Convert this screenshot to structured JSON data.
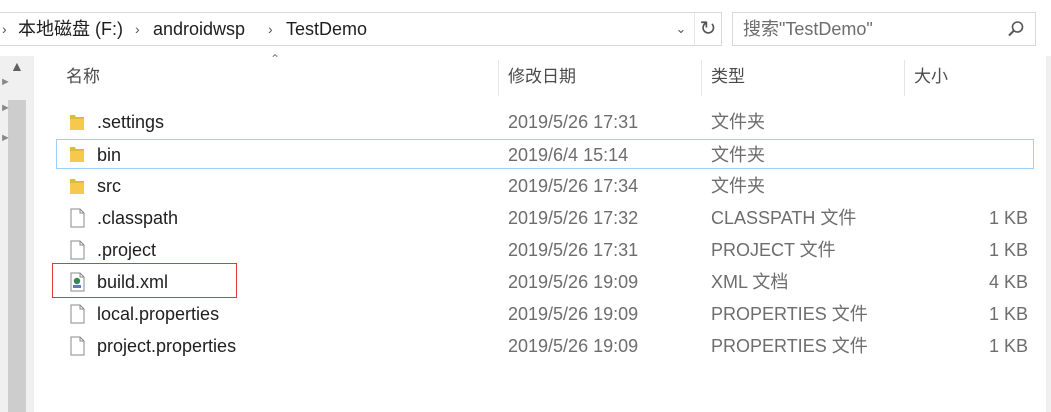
{
  "address": {
    "crumbs": [
      "本地磁盘 (F:)",
      "androidwsp",
      "TestDemo"
    ],
    "separator": "›"
  },
  "search": {
    "placeholder": "搜索\"TestDemo\""
  },
  "columns": {
    "name": "名称",
    "date": "修改日期",
    "type": "类型",
    "size": "大小"
  },
  "rows": [
    {
      "name": ".settings",
      "date": "2019/5/26 17:31",
      "type": "文件夹",
      "size": "",
      "icon": "folder-icon"
    },
    {
      "name": "bin",
      "date": "2019/6/4 15:14",
      "type": "文件夹",
      "size": "",
      "icon": "folder-icon"
    },
    {
      "name": "src",
      "date": "2019/5/26 17:34",
      "type": "文件夹",
      "size": "",
      "icon": "folder-icon"
    },
    {
      "name": ".classpath",
      "date": "2019/5/26 17:32",
      "type": "CLASSPATH 文件",
      "size": "1 KB",
      "icon": "file-icon"
    },
    {
      "name": ".project",
      "date": "2019/5/26 17:31",
      "type": "PROJECT 文件",
      "size": "1 KB",
      "icon": "file-icon"
    },
    {
      "name": "build.xml",
      "date": "2019/5/26 19:09",
      "type": "XML 文档",
      "size": "4 KB",
      "icon": "xml-file-icon"
    },
    {
      "name": "local.properties",
      "date": "2019/5/26 19:09",
      "type": "PROPERTIES 文件",
      "size": "1 KB",
      "icon": "file-icon"
    },
    {
      "name": "project.properties",
      "date": "2019/5/26 19:09",
      "type": "PROPERTIES 文件",
      "size": "1 KB",
      "icon": "file-icon"
    }
  ],
  "colors": {
    "folder": "#e8b73a",
    "hover_border": "#99d1ff",
    "highlight": "#e03a3a"
  }
}
